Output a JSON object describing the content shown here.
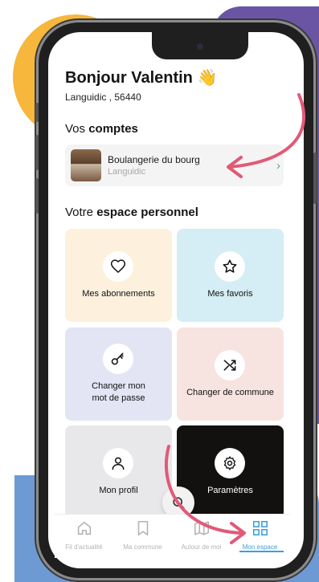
{
  "header": {
    "greeting": "Bonjour Valentin 👋",
    "location": "Languidic , 56440"
  },
  "accounts_section": {
    "prefix": "Vos ",
    "bold": "comptes"
  },
  "account": {
    "name": "Boulangerie du bourg",
    "city": "Languidic",
    "chevron": "›"
  },
  "space_section": {
    "prefix": "Votre ",
    "bold": "espace personnel"
  },
  "tiles": [
    {
      "line1": "Mes abonnements",
      "line2": "",
      "icon": "heart-icon",
      "bg": "#fdf1de"
    },
    {
      "line1": "Mes favoris",
      "line2": "",
      "icon": "star-icon",
      "bg": "#d5edf4"
    },
    {
      "line1": "Changer mon",
      "line2": "mot de passe",
      "icon": "key-icon",
      "bg": "#e3e5f5"
    },
    {
      "line1": "Changer de commune",
      "line2": "",
      "icon": "shuffle-icon",
      "bg": "#f7e3df"
    },
    {
      "line1": "Mon profil",
      "line2": "",
      "icon": "user-icon",
      "bg": "#e8e8ea"
    },
    {
      "line1": "Paramètres",
      "line2": "",
      "icon": "gear-icon",
      "bg": "#131010"
    }
  ],
  "tabbar": [
    {
      "label": "Fil d'actualité",
      "icon": "home-icon",
      "active": false
    },
    {
      "label": "Ma commune",
      "icon": "bookmark-icon",
      "active": false
    },
    {
      "label": "Autour de moi",
      "icon": "map-icon",
      "active": false
    },
    {
      "label": "Mon espace",
      "icon": "grid-icon",
      "active": true
    }
  ],
  "colors": {
    "accent_blue": "#3aa0d8",
    "arrow_pink": "#e05a78",
    "chevron_green": "#45b38a",
    "bg_yellow": "#f6b73c",
    "bg_purple": "#6a55a5",
    "bg_blue": "#6e9ad4"
  }
}
